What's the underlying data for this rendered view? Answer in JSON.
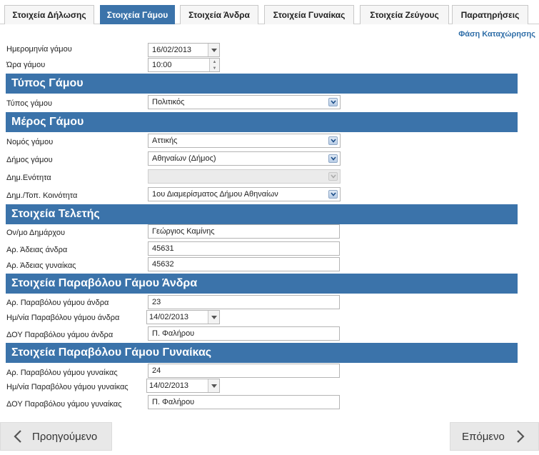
{
  "tabs": [
    {
      "label": "Στοιχεία Δήλωσης",
      "active": false
    },
    {
      "label": "Στοιχεία Γάμου",
      "active": true
    },
    {
      "label": "Στοιχεία Άνδρα",
      "active": false
    },
    {
      "label": "Στοιχεία Γυναίκας",
      "active": false
    },
    {
      "label": "Στοιχεία Ζεύγους",
      "active": false
    },
    {
      "label": "Παρατηρήσεις",
      "active": false
    }
  ],
  "phase_link": "Φάση Καταχώρησης",
  "wedding": {
    "date_label": "Ημερομηνία γάμου",
    "date_value": "16/02/2013",
    "time_label": "Ώρα γάμου",
    "time_value": "10:00"
  },
  "type_section": {
    "title": "Τύπος Γάμου",
    "type_label": "Τύπος γάμου",
    "type_value": "Πολιτικός"
  },
  "place_section": {
    "title": "Μέρος Γάμου",
    "prefecture_label": "Νομός γάμου",
    "prefecture_value": "Αττικής",
    "municipality_label": "Δήμος γάμου",
    "municipality_value": "Αθηναίων (Δήμος)",
    "unit_label": "Δημ.Ενότητα",
    "unit_value": "",
    "community_label": "Δημ./Τοπ. Κοινότητα",
    "community_value": "1ου Διαμερίσματος Δήμου Αθηναίων"
  },
  "ceremony_section": {
    "title": "Στοιχεία Τελετής",
    "mayor_label": "Ον/μο Δημάρχου",
    "mayor_value": "Γεώργιος Καμίνης",
    "man_permit_label": "Αρ. Άδειας άνδρα",
    "man_permit_value": "45631",
    "woman_permit_label": "Αρ. Άδειας γυναίκας",
    "woman_permit_value": "45632"
  },
  "man_fee_section": {
    "title": "Στοιχεία Παραβόλου Γάμου Άνδρα",
    "number_label": "Αρ. Παραβόλου γάμου άνδρα",
    "number_value": "23",
    "date_label": "Ημ/νία Παραβόλου γάμου άνδρα",
    "date_value": "14/02/2013",
    "tax_office_label": "ΔΟΥ Παραβόλου γάμου άνδρα",
    "tax_office_value": "Π. Φαλήρου"
  },
  "woman_fee_section": {
    "title": "Στοιχεία Παραβόλου Γάμου Γυναίκας",
    "number_label": "Αρ. Παραβόλου γάμου γυναίκας",
    "number_value": "24",
    "date_label": "Ημ/νία Παραβόλου γάμου γυναίκας",
    "date_value": "14/02/2013",
    "tax_office_label": "ΔΟΥ Παραβόλου γάμου γυναίκας",
    "tax_office_value": "Π. Φαλήρου"
  },
  "nav": {
    "previous_label": "Προηγούμενο",
    "next_label": "Επόμενο"
  },
  "icons": {
    "select_arrow": "chevron-down-icon",
    "calendar_dropdown": "caret-down-icon",
    "previous": "chevron-left-icon",
    "next": "chevron-right-icon"
  },
  "colors": {
    "accent": "#3b73aa",
    "link": "#2f6ea8"
  }
}
